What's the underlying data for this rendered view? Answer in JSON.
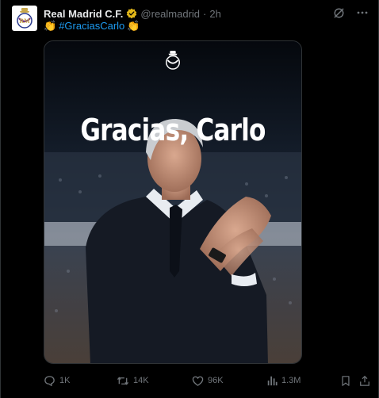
{
  "account": {
    "name": "Real Madrid C.F.",
    "handle": "@realmadrid",
    "separator": "·",
    "time": "2h",
    "avatar_icon": "real-madrid-crest-icon",
    "verified_color": "#e2b719"
  },
  "post": {
    "emoji_left": "👏",
    "hashtag": "#GraciasCarlo",
    "emoji_right": "👏",
    "hashtag_color": "#1d9bf0"
  },
  "media": {
    "headline": "Gracias, Carlo",
    "crest_icon": "real-madrid-crest-icon"
  },
  "actions": {
    "replies": "1K",
    "reposts": "14K",
    "likes": "96K",
    "views": "1.3M"
  },
  "colors": {
    "background": "#000000",
    "text": "#e7e9ea",
    "muted": "#71767b",
    "border": "#2f3336"
  }
}
